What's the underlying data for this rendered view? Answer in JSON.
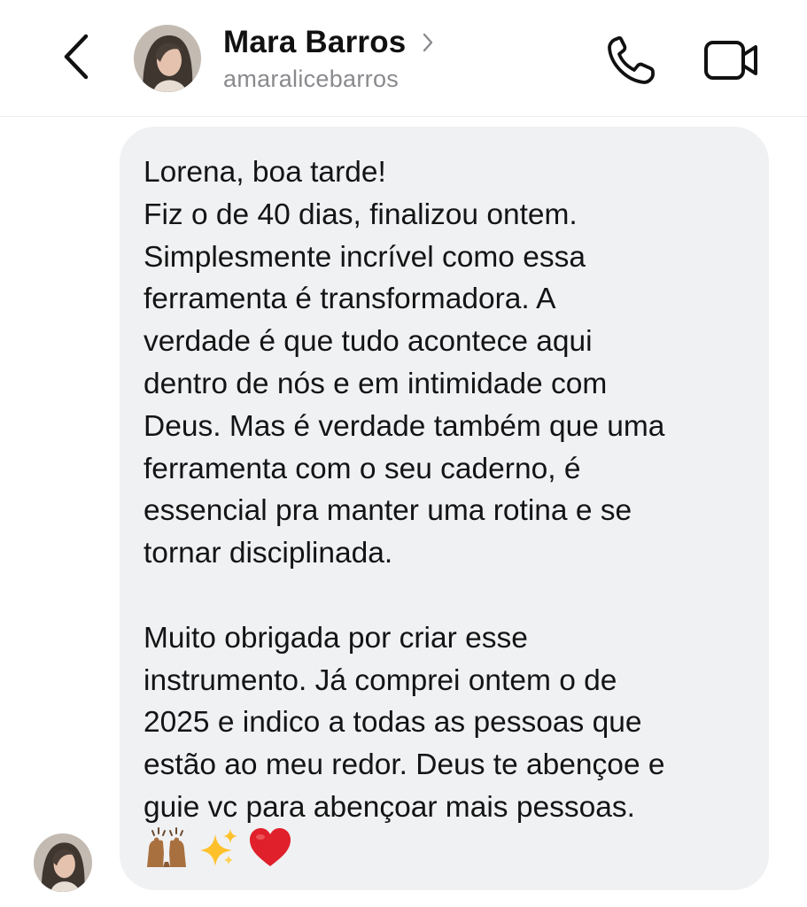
{
  "header": {
    "contact_name": "Mara Barros",
    "username": "amaralicebarros",
    "icons": {
      "back": "chevron-left-icon",
      "profile": "chevron-right-icon",
      "call": "phone-icon",
      "video": "video-camera-icon"
    }
  },
  "message": {
    "lines": [
      "Lorena, boa tarde!",
      "Fiz o de 40 dias, finalizou ontem.",
      "Simplesmente incrível como essa",
      "ferramenta é transformadora. A",
      "verdade é que tudo acontece aqui",
      "dentro de nós e em intimidade com",
      "Deus. Mas é verdade também que uma",
      "ferramenta com o seu caderno, é",
      "essencial pra manter uma rotina e se",
      "tornar disciplinada.",
      "",
      "Muito obrigada por criar esse",
      "instrumento. Já comprei ontem o de",
      "2025 e indico a todas as pessoas que",
      "estão ao meu redor. Deus te abençoe e",
      "guie vc para abençoar mais pessoas."
    ],
    "emojis": [
      "raising-hands-emoji",
      "sparkles-emoji",
      "red-heart-emoji"
    ]
  },
  "colors": {
    "bubble_background": "#f0f1f3",
    "text_primary": "#141414",
    "text_secondary": "#8a8a8e",
    "heart": "#e0202a",
    "sparkle": "#ffc12b"
  }
}
